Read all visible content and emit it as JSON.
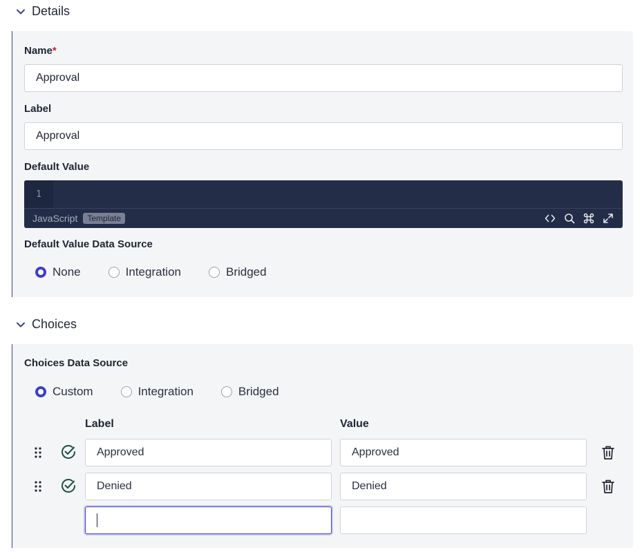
{
  "details": {
    "title": "Details",
    "name_label": "Name",
    "required_mark": "*",
    "name_value": "Approval",
    "label_label": "Label",
    "label_value": "Approval",
    "default_value_label": "Default Value",
    "editor": {
      "line_number": "1",
      "language": "JavaScript",
      "badge": "Template",
      "tools": [
        "code-icon",
        "search-icon",
        "command-icon",
        "expand-icon"
      ]
    },
    "data_source_label": "Default Value Data Source",
    "data_source_options": [
      "None",
      "Integration",
      "Bridged"
    ],
    "data_source_selected": "None"
  },
  "choices": {
    "title": "Choices",
    "data_source_label": "Choices Data Source",
    "data_source_options": [
      "Custom",
      "Integration",
      "Bridged"
    ],
    "data_source_selected": "Custom",
    "col_label": "Label",
    "col_value": "Value",
    "rows": [
      {
        "label": "Approved",
        "value": "Approved"
      },
      {
        "label": "Denied",
        "value": "Denied"
      },
      {
        "label": "",
        "value": ""
      }
    ]
  },
  "colors": {
    "accent": "#3b3fc9",
    "editor_bg": "#232d48",
    "check": "#1f4f3f",
    "required": "#d11a2a"
  }
}
